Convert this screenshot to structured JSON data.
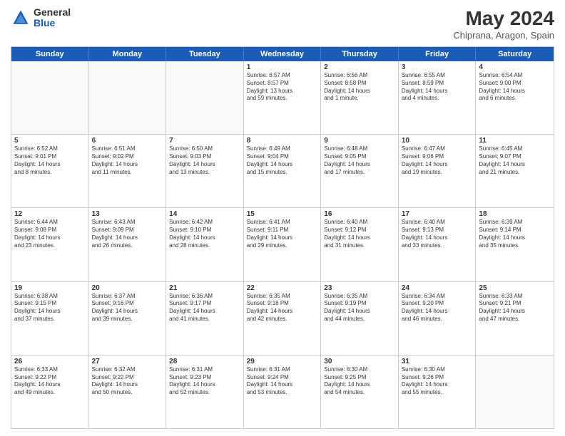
{
  "header": {
    "logo_general": "General",
    "logo_blue": "Blue",
    "title": "May 2024",
    "subtitle": "Chiprana, Aragon, Spain"
  },
  "calendar": {
    "days_of_week": [
      "Sunday",
      "Monday",
      "Tuesday",
      "Wednesday",
      "Thursday",
      "Friday",
      "Saturday"
    ],
    "weeks": [
      [
        {
          "day": "",
          "lines": []
        },
        {
          "day": "",
          "lines": []
        },
        {
          "day": "",
          "lines": []
        },
        {
          "day": "1",
          "lines": [
            "Sunrise: 6:57 AM",
            "Sunset: 8:57 PM",
            "Daylight: 13 hours",
            "and 59 minutes."
          ]
        },
        {
          "day": "2",
          "lines": [
            "Sunrise: 6:56 AM",
            "Sunset: 8:58 PM",
            "Daylight: 14 hours",
            "and 1 minute."
          ]
        },
        {
          "day": "3",
          "lines": [
            "Sunrise: 6:55 AM",
            "Sunset: 8:59 PM",
            "Daylight: 14 hours",
            "and 4 minutes."
          ]
        },
        {
          "day": "4",
          "lines": [
            "Sunrise: 6:54 AM",
            "Sunset: 9:00 PM",
            "Daylight: 14 hours",
            "and 6 minutes."
          ]
        }
      ],
      [
        {
          "day": "5",
          "lines": [
            "Sunrise: 6:52 AM",
            "Sunset: 9:01 PM",
            "Daylight: 14 hours",
            "and 8 minutes."
          ]
        },
        {
          "day": "6",
          "lines": [
            "Sunrise: 6:51 AM",
            "Sunset: 9:02 PM",
            "Daylight: 14 hours",
            "and 11 minutes."
          ]
        },
        {
          "day": "7",
          "lines": [
            "Sunrise: 6:50 AM",
            "Sunset: 9:03 PM",
            "Daylight: 14 hours",
            "and 13 minutes."
          ]
        },
        {
          "day": "8",
          "lines": [
            "Sunrise: 6:49 AM",
            "Sunset: 9:04 PM",
            "Daylight: 14 hours",
            "and 15 minutes."
          ]
        },
        {
          "day": "9",
          "lines": [
            "Sunrise: 6:48 AM",
            "Sunset: 9:05 PM",
            "Daylight: 14 hours",
            "and 17 minutes."
          ]
        },
        {
          "day": "10",
          "lines": [
            "Sunrise: 6:47 AM",
            "Sunset: 9:06 PM",
            "Daylight: 14 hours",
            "and 19 minutes."
          ]
        },
        {
          "day": "11",
          "lines": [
            "Sunrise: 6:45 AM",
            "Sunset: 9:07 PM",
            "Daylight: 14 hours",
            "and 21 minutes."
          ]
        }
      ],
      [
        {
          "day": "12",
          "lines": [
            "Sunrise: 6:44 AM",
            "Sunset: 9:08 PM",
            "Daylight: 14 hours",
            "and 23 minutes."
          ]
        },
        {
          "day": "13",
          "lines": [
            "Sunrise: 6:43 AM",
            "Sunset: 9:09 PM",
            "Daylight: 14 hours",
            "and 26 minutes."
          ]
        },
        {
          "day": "14",
          "lines": [
            "Sunrise: 6:42 AM",
            "Sunset: 9:10 PM",
            "Daylight: 14 hours",
            "and 28 minutes."
          ]
        },
        {
          "day": "15",
          "lines": [
            "Sunrise: 6:41 AM",
            "Sunset: 9:11 PM",
            "Daylight: 14 hours",
            "and 29 minutes."
          ]
        },
        {
          "day": "16",
          "lines": [
            "Sunrise: 6:40 AM",
            "Sunset: 9:12 PM",
            "Daylight: 14 hours",
            "and 31 minutes."
          ]
        },
        {
          "day": "17",
          "lines": [
            "Sunrise: 6:40 AM",
            "Sunset: 9:13 PM",
            "Daylight: 14 hours",
            "and 33 minutes."
          ]
        },
        {
          "day": "18",
          "lines": [
            "Sunrise: 6:39 AM",
            "Sunset: 9:14 PM",
            "Daylight: 14 hours",
            "and 35 minutes."
          ]
        }
      ],
      [
        {
          "day": "19",
          "lines": [
            "Sunrise: 6:38 AM",
            "Sunset: 9:15 PM",
            "Daylight: 14 hours",
            "and 37 minutes."
          ]
        },
        {
          "day": "20",
          "lines": [
            "Sunrise: 6:37 AM",
            "Sunset: 9:16 PM",
            "Daylight: 14 hours",
            "and 39 minutes."
          ]
        },
        {
          "day": "21",
          "lines": [
            "Sunrise: 6:36 AM",
            "Sunset: 9:17 PM",
            "Daylight: 14 hours",
            "and 41 minutes."
          ]
        },
        {
          "day": "22",
          "lines": [
            "Sunrise: 6:35 AM",
            "Sunset: 9:18 PM",
            "Daylight: 14 hours",
            "and 42 minutes."
          ]
        },
        {
          "day": "23",
          "lines": [
            "Sunrise: 6:35 AM",
            "Sunset: 9:19 PM",
            "Daylight: 14 hours",
            "and 44 minutes."
          ]
        },
        {
          "day": "24",
          "lines": [
            "Sunrise: 6:34 AM",
            "Sunset: 9:20 PM",
            "Daylight: 14 hours",
            "and 46 minutes."
          ]
        },
        {
          "day": "25",
          "lines": [
            "Sunrise: 6:33 AM",
            "Sunset: 9:21 PM",
            "Daylight: 14 hours",
            "and 47 minutes."
          ]
        }
      ],
      [
        {
          "day": "26",
          "lines": [
            "Sunrise: 6:33 AM",
            "Sunset: 9:22 PM",
            "Daylight: 14 hours",
            "and 49 minutes."
          ]
        },
        {
          "day": "27",
          "lines": [
            "Sunrise: 6:32 AM",
            "Sunset: 9:22 PM",
            "Daylight: 14 hours",
            "and 50 minutes."
          ]
        },
        {
          "day": "28",
          "lines": [
            "Sunrise: 6:31 AM",
            "Sunset: 9:23 PM",
            "Daylight: 14 hours",
            "and 52 minutes."
          ]
        },
        {
          "day": "29",
          "lines": [
            "Sunrise: 6:31 AM",
            "Sunset: 9:24 PM",
            "Daylight: 14 hours",
            "and 53 minutes."
          ]
        },
        {
          "day": "30",
          "lines": [
            "Sunrise: 6:30 AM",
            "Sunset: 9:25 PM",
            "Daylight: 14 hours",
            "and 54 minutes."
          ]
        },
        {
          "day": "31",
          "lines": [
            "Sunrise: 6:30 AM",
            "Sunset: 9:26 PM",
            "Daylight: 14 hours",
            "and 55 minutes."
          ]
        },
        {
          "day": "",
          "lines": []
        }
      ]
    ]
  }
}
